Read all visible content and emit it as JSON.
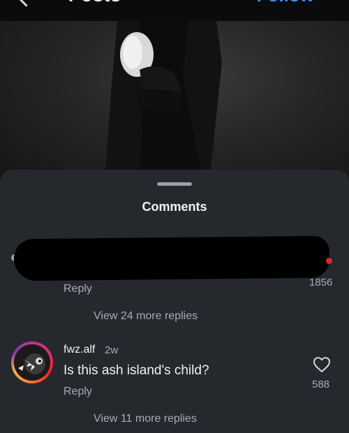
{
  "topbar": {
    "title": "Posts",
    "follow_label": "Follow"
  },
  "sheet": {
    "title": "Comments"
  },
  "first_comment": {
    "like_count": "1856",
    "reply_label": "Reply",
    "view_more_label": "View 24 more replies"
  },
  "second_comment": {
    "username": "fwz.alf",
    "time": "2w",
    "text": "Is this ash island's child?",
    "like_count": "588",
    "reply_label": "Reply",
    "view_more_label": "View 11 more replies"
  },
  "icons": {
    "back": "chevron-left-icon",
    "like": "heart-outline-icon"
  },
  "colors": {
    "sheet_bg": "#25282d",
    "accent": "#3b8ff6",
    "muted_text": "#a9adb3"
  }
}
